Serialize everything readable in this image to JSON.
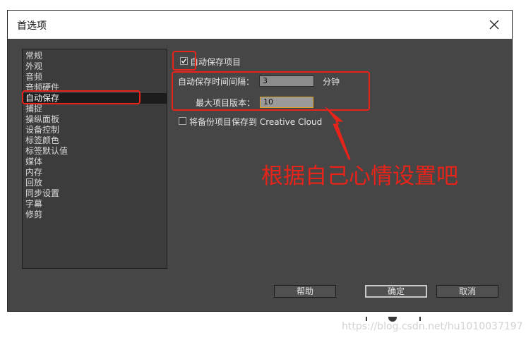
{
  "dialog": {
    "title": "首选项",
    "close_icon": "close-icon"
  },
  "sidebar": {
    "items": [
      {
        "label": "常规",
        "selected": false
      },
      {
        "label": "外观",
        "selected": false
      },
      {
        "label": "音频",
        "selected": false
      },
      {
        "label": "音频硬件",
        "selected": false
      },
      {
        "label": "自动保存",
        "selected": true
      },
      {
        "label": "捕捉",
        "selected": false
      },
      {
        "label": "操纵面板",
        "selected": false
      },
      {
        "label": "设备控制",
        "selected": false
      },
      {
        "label": "标签颜色",
        "selected": false
      },
      {
        "label": "标签默认值",
        "selected": false
      },
      {
        "label": "媒体",
        "selected": false
      },
      {
        "label": "内存",
        "selected": false
      },
      {
        "label": "回放",
        "selected": false
      },
      {
        "label": "同步设置",
        "selected": false
      },
      {
        "label": "字幕",
        "selected": false
      },
      {
        "label": "修剪",
        "selected": false
      }
    ]
  },
  "autosave": {
    "enable_label": "自动保存项目",
    "enable_checked": true,
    "interval_label": "自动保存时间间隔：",
    "interval_value": "3",
    "interval_unit": "分钟",
    "max_versions_label": "最大项目版本：",
    "max_versions_value": "10",
    "cloud_label": "将备份项目保存到 Creative Cloud",
    "cloud_checked": false
  },
  "buttons": {
    "help": "帮助",
    "ok": "确定",
    "cancel": "取消"
  },
  "annotation": {
    "text": "根据自己心情设置吧",
    "color": "#e8231a"
  },
  "watermark": "https://blog.csdn.net/hu1010037197"
}
